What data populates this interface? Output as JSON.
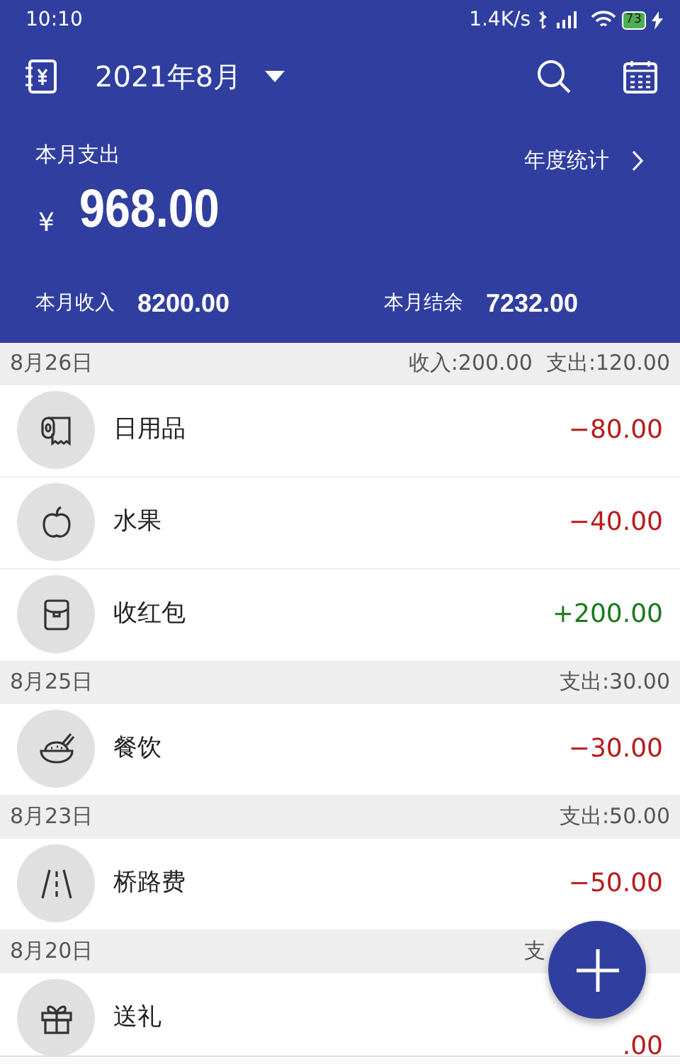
{
  "status_bar": {
    "time": "10:10",
    "network_speed": "1.4K/s",
    "battery": "73"
  },
  "toolbar": {
    "month": "2021年8月"
  },
  "summary": {
    "label": "本月支出",
    "currency": "¥",
    "amount": "968.00",
    "yearly_link": "年度统计",
    "income_label": "本月收入",
    "income": "8200.00",
    "balance_label": "本月结余",
    "balance": "7232.00"
  },
  "days": [
    {
      "date": "8月26日",
      "totals": "收入:200.00  支出:120.00",
      "entries": [
        {
          "kind": "paper",
          "name": "日用品",
          "amount": "−80.00",
          "color": "#b71c1c"
        },
        {
          "kind": "apple",
          "name": "水果",
          "amount": "−40.00",
          "color": "#b71c1c"
        },
        {
          "kind": "envelope",
          "name": "收红包",
          "amount": "+200.00",
          "color": "#1b7a1b"
        }
      ]
    },
    {
      "date": "8月25日",
      "totals": "支出:30.00",
      "entries": [
        {
          "kind": "bowl",
          "name": "餐饮",
          "amount": "−30.00",
          "color": "#b71c1c"
        }
      ]
    },
    {
      "date": "8月23日",
      "totals": "支出:50.00",
      "entries": [
        {
          "kind": "road",
          "name": "桥路费",
          "amount": "−50.00",
          "color": "#b71c1c"
        }
      ]
    },
    {
      "date": "8月20日",
      "totals": "支",
      "entries": [
        {
          "kind": "gift",
          "name": "送礼",
          "amount": ".00",
          "color": "#b71c1c"
        }
      ]
    }
  ]
}
